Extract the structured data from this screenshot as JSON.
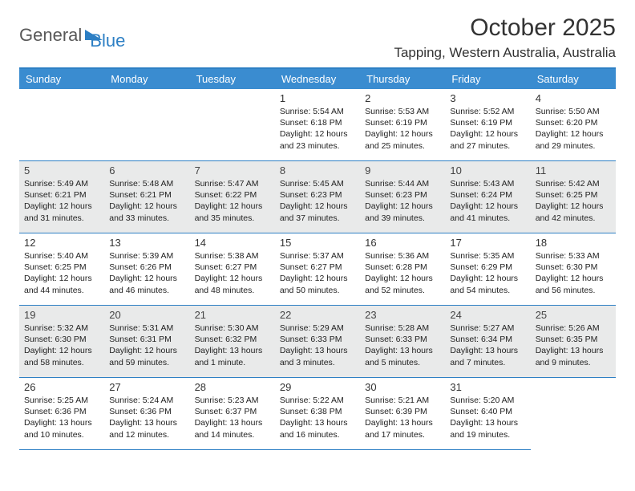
{
  "logo": {
    "part1": "General",
    "part2": "Blue"
  },
  "title": "October 2025",
  "location": "Tapping, Western Australia, Australia",
  "weekdays": [
    "Sunday",
    "Monday",
    "Tuesday",
    "Wednesday",
    "Thursday",
    "Friday",
    "Saturday"
  ],
  "startOffset": 3,
  "days": [
    {
      "n": 1,
      "sr": "5:54 AM",
      "ss": "6:18 PM",
      "dl": "12 hours and 23 minutes."
    },
    {
      "n": 2,
      "sr": "5:53 AM",
      "ss": "6:19 PM",
      "dl": "12 hours and 25 minutes."
    },
    {
      "n": 3,
      "sr": "5:52 AM",
      "ss": "6:19 PM",
      "dl": "12 hours and 27 minutes."
    },
    {
      "n": 4,
      "sr": "5:50 AM",
      "ss": "6:20 PM",
      "dl": "12 hours and 29 minutes."
    },
    {
      "n": 5,
      "sr": "5:49 AM",
      "ss": "6:21 PM",
      "dl": "12 hours and 31 minutes."
    },
    {
      "n": 6,
      "sr": "5:48 AM",
      "ss": "6:21 PM",
      "dl": "12 hours and 33 minutes."
    },
    {
      "n": 7,
      "sr": "5:47 AM",
      "ss": "6:22 PM",
      "dl": "12 hours and 35 minutes."
    },
    {
      "n": 8,
      "sr": "5:45 AM",
      "ss": "6:23 PM",
      "dl": "12 hours and 37 minutes."
    },
    {
      "n": 9,
      "sr": "5:44 AM",
      "ss": "6:23 PM",
      "dl": "12 hours and 39 minutes."
    },
    {
      "n": 10,
      "sr": "5:43 AM",
      "ss": "6:24 PM",
      "dl": "12 hours and 41 minutes."
    },
    {
      "n": 11,
      "sr": "5:42 AM",
      "ss": "6:25 PM",
      "dl": "12 hours and 42 minutes."
    },
    {
      "n": 12,
      "sr": "5:40 AM",
      "ss": "6:25 PM",
      "dl": "12 hours and 44 minutes."
    },
    {
      "n": 13,
      "sr": "5:39 AM",
      "ss": "6:26 PM",
      "dl": "12 hours and 46 minutes."
    },
    {
      "n": 14,
      "sr": "5:38 AM",
      "ss": "6:27 PM",
      "dl": "12 hours and 48 minutes."
    },
    {
      "n": 15,
      "sr": "5:37 AM",
      "ss": "6:27 PM",
      "dl": "12 hours and 50 minutes."
    },
    {
      "n": 16,
      "sr": "5:36 AM",
      "ss": "6:28 PM",
      "dl": "12 hours and 52 minutes."
    },
    {
      "n": 17,
      "sr": "5:35 AM",
      "ss": "6:29 PM",
      "dl": "12 hours and 54 minutes."
    },
    {
      "n": 18,
      "sr": "5:33 AM",
      "ss": "6:30 PM",
      "dl": "12 hours and 56 minutes."
    },
    {
      "n": 19,
      "sr": "5:32 AM",
      "ss": "6:30 PM",
      "dl": "12 hours and 58 minutes."
    },
    {
      "n": 20,
      "sr": "5:31 AM",
      "ss": "6:31 PM",
      "dl": "12 hours and 59 minutes."
    },
    {
      "n": 21,
      "sr": "5:30 AM",
      "ss": "6:32 PM",
      "dl": "13 hours and 1 minute."
    },
    {
      "n": 22,
      "sr": "5:29 AM",
      "ss": "6:33 PM",
      "dl": "13 hours and 3 minutes."
    },
    {
      "n": 23,
      "sr": "5:28 AM",
      "ss": "6:33 PM",
      "dl": "13 hours and 5 minutes."
    },
    {
      "n": 24,
      "sr": "5:27 AM",
      "ss": "6:34 PM",
      "dl": "13 hours and 7 minutes."
    },
    {
      "n": 25,
      "sr": "5:26 AM",
      "ss": "6:35 PM",
      "dl": "13 hours and 9 minutes."
    },
    {
      "n": 26,
      "sr": "5:25 AM",
      "ss": "6:36 PM",
      "dl": "13 hours and 10 minutes."
    },
    {
      "n": 27,
      "sr": "5:24 AM",
      "ss": "6:36 PM",
      "dl": "13 hours and 12 minutes."
    },
    {
      "n": 28,
      "sr": "5:23 AM",
      "ss": "6:37 PM",
      "dl": "13 hours and 14 minutes."
    },
    {
      "n": 29,
      "sr": "5:22 AM",
      "ss": "6:38 PM",
      "dl": "13 hours and 16 minutes."
    },
    {
      "n": 30,
      "sr": "5:21 AM",
      "ss": "6:39 PM",
      "dl": "13 hours and 17 minutes."
    },
    {
      "n": 31,
      "sr": "5:20 AM",
      "ss": "6:40 PM",
      "dl": "13 hours and 19 minutes."
    }
  ],
  "labels": {
    "sunrise": "Sunrise:",
    "sunset": "Sunset:",
    "daylight": "Daylight:"
  }
}
